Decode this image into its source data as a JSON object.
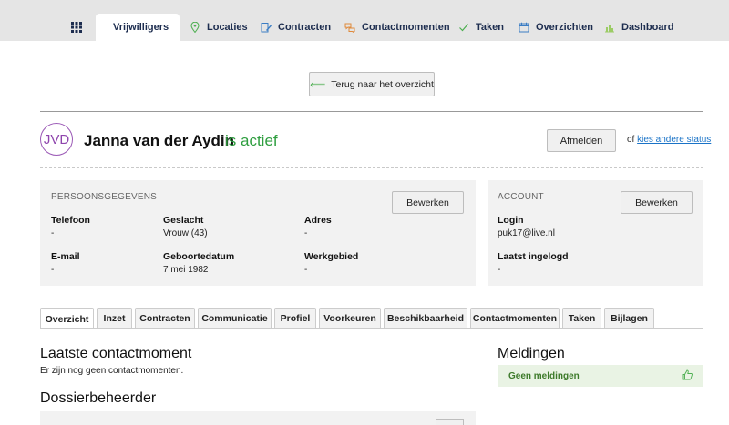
{
  "nav": {
    "tabs": [
      {
        "label": "",
        "icon": "grid-icon"
      },
      {
        "label": "Vrijwilligers",
        "icon": "user-icon"
      },
      {
        "label": "Locaties",
        "icon": "map-pin-icon"
      },
      {
        "label": "Contracten",
        "icon": "edit-document-icon"
      },
      {
        "label": "Contactmomenten",
        "icon": "chat-bubbles-icon"
      },
      {
        "label": "Taken",
        "icon": "checkmark-icon"
      },
      {
        "label": "Overzichten",
        "icon": "calendar-icon"
      },
      {
        "label": "Dashboard",
        "icon": "bar-chart-icon"
      }
    ],
    "active": "Vrijwilligers"
  },
  "back_button": "Terug naar het overzicht",
  "person": {
    "initials": "JVD",
    "name": "Janna van der Aydin",
    "status": "is actief",
    "afmelden": "Afmelden",
    "status_of": "of",
    "status_link": "kies andere status"
  },
  "persoonsgegevens": {
    "title": "PERSOONSGEGEVENS",
    "edit": "Bewerken",
    "fields": {
      "telefoon_label": "Telefoon",
      "telefoon_value": "-",
      "geslacht_label": "Geslacht",
      "geslacht_value": "Vrouw (43)",
      "adres_label": "Adres",
      "adres_value": "-",
      "email_label": "E-mail",
      "email_value": "-",
      "geboortedatum_label": "Geboortedatum",
      "geboortedatum_value": "7 mei 1982",
      "werkgebied_label": "Werkgebied",
      "werkgebied_value": "-"
    }
  },
  "account": {
    "title": "ACCOUNT",
    "edit": "Bewerken",
    "login_label": "Login",
    "login_value": "puk17@live.nl",
    "laatst_label": "Laatst ingelogd",
    "laatst_value": "-"
  },
  "subtabs": [
    "Overzicht",
    "Inzet",
    "Contracten",
    "Communicatie",
    "Profiel",
    "Voorkeuren",
    "Beschikbaarheid",
    "Contactmomenten",
    "Taken",
    "Bijlagen"
  ],
  "overview": {
    "contact_title": "Laatste contactmoment",
    "contact_empty": "Er zijn nog geen contactmomenten.",
    "dossier_title": "Dossierbeheerder",
    "meldingen_title": "Meldingen",
    "meldingen_empty": "Geen meldingen"
  },
  "colors": {
    "accent_purple": "#9b59b6",
    "active_green": "#2e9e3f",
    "link_blue": "#1a73c7",
    "nav_text": "#1d2d4f"
  }
}
